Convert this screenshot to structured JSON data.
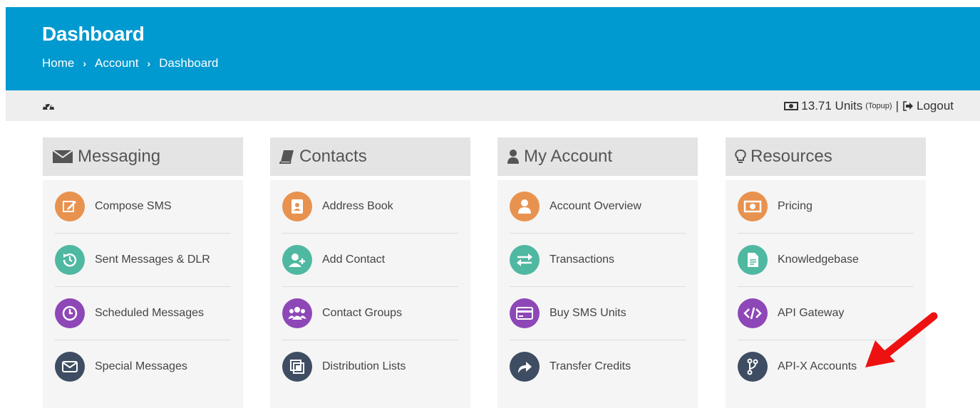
{
  "header": {
    "title": "Dashboard",
    "breadcrumb": [
      "Home",
      "Account",
      "Dashboard"
    ],
    "separator": "›"
  },
  "toolbar": {
    "units": "13.71 Units",
    "units_type": "(Topup)",
    "pipe": "|",
    "logout": "Logout"
  },
  "cards": [
    {
      "title": "Messaging",
      "icon": "envelope-icon",
      "items": [
        {
          "label": "Compose SMS",
          "icon": "compose-icon",
          "color": "#e8924f"
        },
        {
          "label": "Sent Messages & DLR",
          "icon": "history-icon",
          "color": "#4fb8a0"
        },
        {
          "label": "Scheduled Messages",
          "icon": "clock-icon",
          "color": "#8e47b7"
        },
        {
          "label": "Special Messages",
          "icon": "envelope-icon",
          "color": "#3e4d62"
        }
      ]
    },
    {
      "title": "Contacts",
      "icon": "book-icon",
      "items": [
        {
          "label": "Address Book",
          "icon": "address-book-icon",
          "color": "#e8924f"
        },
        {
          "label": "Add Contact",
          "icon": "user-plus-icon",
          "color": "#4fb8a0"
        },
        {
          "label": "Contact Groups",
          "icon": "users-icon",
          "color": "#8e47b7"
        },
        {
          "label": "Distribution Lists",
          "icon": "copy-icon",
          "color": "#3e4d62"
        }
      ]
    },
    {
      "title": "My Account",
      "icon": "user-icon",
      "items": [
        {
          "label": "Account Overview",
          "icon": "user-icon",
          "color": "#e8924f"
        },
        {
          "label": "Transactions",
          "icon": "exchange-icon",
          "color": "#4fb8a0"
        },
        {
          "label": "Buy SMS Units",
          "icon": "credit-card-icon",
          "color": "#8e47b7"
        },
        {
          "label": "Transfer Credits",
          "icon": "share-icon",
          "color": "#3e4d62"
        }
      ]
    },
    {
      "title": "Resources",
      "icon": "lightbulb-icon",
      "items": [
        {
          "label": "Pricing",
          "icon": "money-icon",
          "color": "#e8924f"
        },
        {
          "label": "Knowledgebase",
          "icon": "document-icon",
          "color": "#4fb8a0"
        },
        {
          "label": "API Gateway",
          "icon": "code-icon",
          "color": "#8e47b7"
        },
        {
          "label": "API-X Accounts",
          "icon": "branch-icon",
          "color": "#3e4d62"
        }
      ]
    }
  ],
  "annotation": {
    "arrow_color": "#ee1111",
    "points_to": "API-X Accounts"
  }
}
